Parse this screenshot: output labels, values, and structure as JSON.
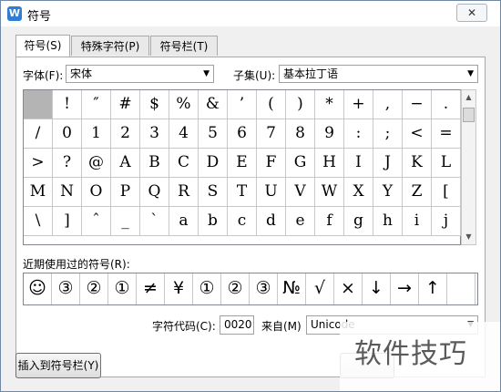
{
  "window": {
    "title": "符号",
    "app_icon": "W",
    "close": "✕"
  },
  "tabs": [
    {
      "label": "符号(S)"
    },
    {
      "label": "特殊字符(P)"
    },
    {
      "label": "符号栏(T)"
    }
  ],
  "font": {
    "label": "字体(F):",
    "value": "宋体"
  },
  "subset": {
    "label": "子集(U):",
    "value": "基本拉丁语"
  },
  "symbols": [
    [
      "",
      "!",
      "″",
      "#",
      "$",
      "%",
      "&",
      "’",
      "(",
      ")",
      "*",
      "+",
      ",",
      "−",
      "."
    ],
    [
      "/",
      "0",
      "1",
      "2",
      "3",
      "4",
      "5",
      "6",
      "7",
      "8",
      "9",
      ":",
      ";",
      "<",
      "="
    ],
    [
      ">",
      "?",
      "@",
      "A",
      "B",
      "C",
      "D",
      "E",
      "F",
      "G",
      "H",
      "I",
      "J",
      "K",
      "L"
    ],
    [
      "M",
      "N",
      "O",
      "P",
      "Q",
      "R",
      "S",
      "T",
      "U",
      "V",
      "W",
      "X",
      "Y",
      "Z",
      "["
    ],
    [
      "\\",
      "]",
      "ˆ",
      "_",
      "`",
      "a",
      "b",
      "c",
      "d",
      "e",
      "f",
      "g",
      "h",
      "i",
      "j"
    ]
  ],
  "recent": {
    "label": "近期使用过的符号(R):",
    "items": [
      "☺",
      "③",
      "②",
      "①",
      "≠",
      "¥",
      "①",
      "②",
      "③",
      "№",
      "√",
      "×",
      "↓",
      "→",
      "↑",
      ""
    ]
  },
  "char_code": {
    "label": "字符代码(C):",
    "value": "0020"
  },
  "from": {
    "label": "来自(M)",
    "value": "Unicode"
  },
  "buttons": {
    "insert_to_bar": "插入到符号栏(Y)"
  },
  "watermark": "软件技巧"
}
